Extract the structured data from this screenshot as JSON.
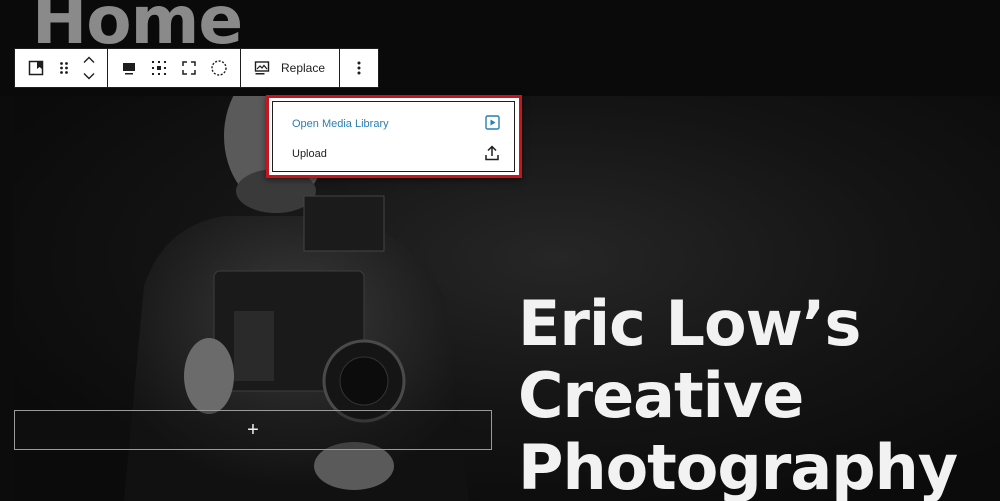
{
  "page": {
    "title": "Home"
  },
  "toolbar": {
    "replace_label": "Replace",
    "icons": [
      "cover-block-icon",
      "drag-handle-icon",
      "move-up-icon",
      "move-down-icon",
      "align-icon",
      "content-position-icon",
      "fullscreen-icon",
      "duotone-icon",
      "media-icon",
      "more-options-icon"
    ]
  },
  "replace_menu": {
    "items": [
      {
        "label": "Open Media Library",
        "icon": "media-library-icon",
        "color": "#2a7fb0"
      },
      {
        "label": "Upload",
        "icon": "upload-icon",
        "color": "#1e1e1e"
      }
    ],
    "highlight_color": "#c8151d"
  },
  "cover": {
    "heading_lines": [
      "Eric Low’s",
      "Creative",
      "Photography"
    ],
    "appender_symbol": "+"
  }
}
